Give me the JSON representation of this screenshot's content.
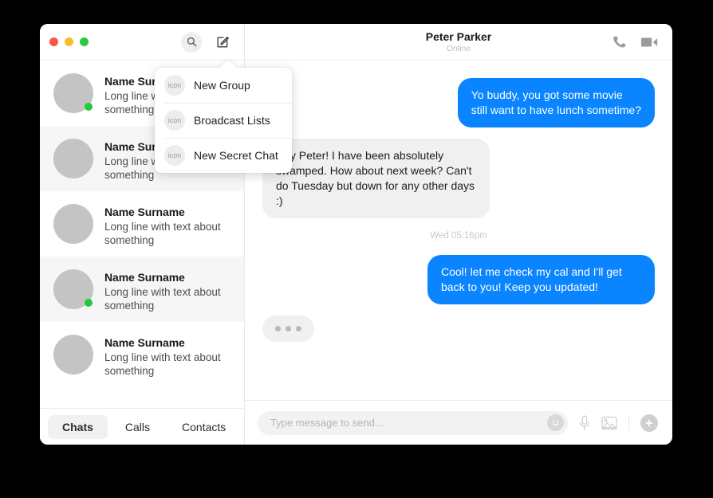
{
  "window": {
    "traffic_lights": [
      {
        "name": "close",
        "color": "#f8564b"
      },
      {
        "name": "minimize",
        "color": "#fbbd2e"
      },
      {
        "name": "zoom",
        "color": "#2ac940"
      }
    ]
  },
  "sidebar": {
    "toolbar": {
      "search_icon": "search-icon",
      "compose_icon": "compose-icon"
    },
    "chats": [
      {
        "name": "Name Surname",
        "preview": "Long line with text about something",
        "online": true,
        "selected": false
      },
      {
        "name": "Name Surname",
        "preview": "Long line with text about something",
        "online": false,
        "selected": true
      },
      {
        "name": "Name Surname",
        "preview": "Long line with text about something",
        "online": false,
        "selected": false
      },
      {
        "name": "Name Surname",
        "preview": "Long line with text about something",
        "online": true,
        "selected": true
      },
      {
        "name": "Name Surname",
        "preview": "Long line with text about something",
        "online": false,
        "selected": false
      }
    ],
    "tabs": [
      {
        "label": "Chats",
        "active": true
      },
      {
        "label": "Calls",
        "active": false
      },
      {
        "label": "Contacts",
        "active": false
      }
    ]
  },
  "compose_menu": {
    "items": [
      {
        "icon_label": "icon",
        "label": "New Group"
      },
      {
        "icon_label": "icon",
        "label": "Broadcast Lists"
      },
      {
        "icon_label": "icon",
        "label": "New Secret Chat"
      }
    ]
  },
  "conversation": {
    "contact_name": "Peter Parker",
    "status": "Online",
    "call_icon": "phone-icon",
    "video_icon": "video-camera-icon",
    "messages": [
      {
        "type": "bubble",
        "direction": "out",
        "text": "Yo buddy, you got some movie\nstill want to have lunch sometime?"
      },
      {
        "type": "bubble",
        "direction": "in",
        "text": "Hey Peter! I have been absolutely swamped. How about next week? Can't do Tuesday but down for any other days :)"
      },
      {
        "type": "timestamp",
        "text": "Wed 05:16pm"
      },
      {
        "type": "bubble",
        "direction": "out",
        "text": "Cool! let me check my cal and I'll get back to you! Keep you updated!"
      },
      {
        "type": "typing",
        "direction": "in"
      }
    ]
  },
  "composer": {
    "placeholder": "Type message to send...",
    "value": "",
    "emoji_icon": "smiley-icon",
    "mic_icon": "microphone-icon",
    "image_icon": "image-icon",
    "add_icon": "plus-icon"
  },
  "colors": {
    "accent_blue": "#0a85ff",
    "incoming_bubble": "#f0f0f0",
    "online_green": "#22c93c",
    "row_selected": "#f6f6f6"
  }
}
